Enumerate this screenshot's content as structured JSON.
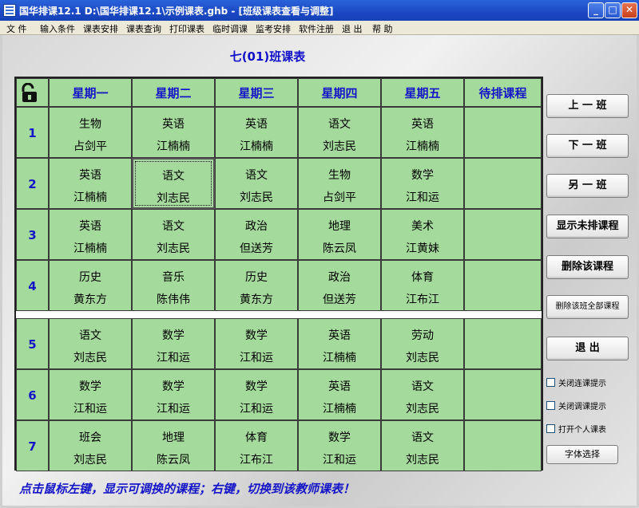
{
  "window": {
    "title": "国华排课12.1   D:\\国华排课12.1\\示例课表.ghb - [班级课表查看与调整]",
    "minimize": "_",
    "maximize": "□",
    "close": "✕"
  },
  "menu": [
    "文 件",
    "输入条件",
    "课表安排",
    "课表查询",
    "打印课表",
    "临时调课",
    "监考安排",
    "软件注册",
    "退 出",
    "帮 助"
  ],
  "class_title": "七(01)班课表",
  "headers": [
    "星期一",
    "星期二",
    "星期三",
    "星期四",
    "星期五",
    "待排课程"
  ],
  "periods": [
    "1",
    "2",
    "3",
    "4",
    "5",
    "6",
    "7"
  ],
  "schedule": [
    [
      {
        "s": "生物",
        "t": "占剑平"
      },
      {
        "s": "英语",
        "t": "江楠楠"
      },
      {
        "s": "英语",
        "t": "江楠楠"
      },
      {
        "s": "语文",
        "t": "刘志民"
      },
      {
        "s": "英语",
        "t": "江楠楠"
      },
      {
        "s": "",
        "t": ""
      }
    ],
    [
      {
        "s": "英语",
        "t": "江楠楠"
      },
      {
        "s": "语文",
        "t": "刘志民"
      },
      {
        "s": "语文",
        "t": "刘志民"
      },
      {
        "s": "生物",
        "t": "占剑平"
      },
      {
        "s": "数学",
        "t": "江和运"
      },
      {
        "s": "",
        "t": ""
      }
    ],
    [
      {
        "s": "英语",
        "t": "江楠楠"
      },
      {
        "s": "语文",
        "t": "刘志民"
      },
      {
        "s": "政治",
        "t": "但送芳"
      },
      {
        "s": "地理",
        "t": "陈云凤"
      },
      {
        "s": "美术",
        "t": "江黄妹"
      },
      {
        "s": "",
        "t": ""
      }
    ],
    [
      {
        "s": "历史",
        "t": "黄东方"
      },
      {
        "s": "音乐",
        "t": "陈伟伟"
      },
      {
        "s": "历史",
        "t": "黄东方"
      },
      {
        "s": "政治",
        "t": "但送芳"
      },
      {
        "s": "体育",
        "t": "江布江"
      },
      {
        "s": "",
        "t": ""
      }
    ],
    [
      {
        "s": "语文",
        "t": "刘志民"
      },
      {
        "s": "数学",
        "t": "江和运"
      },
      {
        "s": "数学",
        "t": "江和运"
      },
      {
        "s": "英语",
        "t": "江楠楠"
      },
      {
        "s": "劳动",
        "t": "刘志民"
      },
      {
        "s": "",
        "t": ""
      }
    ],
    [
      {
        "s": "数学",
        "t": "江和运"
      },
      {
        "s": "数学",
        "t": "江和运"
      },
      {
        "s": "数学",
        "t": "江和运"
      },
      {
        "s": "英语",
        "t": "江楠楠"
      },
      {
        "s": "语文",
        "t": "刘志民"
      },
      {
        "s": "",
        "t": ""
      }
    ],
    [
      {
        "s": "班会",
        "t": "刘志民"
      },
      {
        "s": "地理",
        "t": "陈云凤"
      },
      {
        "s": "体育",
        "t": "江布江"
      },
      {
        "s": "数学",
        "t": "江和运"
      },
      {
        "s": "语文",
        "t": "刘志民"
      },
      {
        "s": "",
        "t": ""
      }
    ]
  ],
  "selected_cell": {
    "period": 2,
    "day": 2
  },
  "buttons": {
    "prev": "上 一 班",
    "next": "下 一 班",
    "other": "另 一 班",
    "show_unscheduled": "显示未排课程",
    "delete_course": "删除该课程",
    "delete_all": "删除该班全部课程",
    "exit": "退   出",
    "font_select": "字体选择"
  },
  "checkboxes": [
    "关闭连课提示",
    "关闭调课提示",
    "打开个人课表"
  ],
  "hint": "点击鼠标左键，显示可调换的课程；右键，切换到该教师课表！",
  "colors": {
    "cell_green": "#a4da9b",
    "accent_blue": "#1515c8",
    "titlebar": "#1a48c4"
  }
}
